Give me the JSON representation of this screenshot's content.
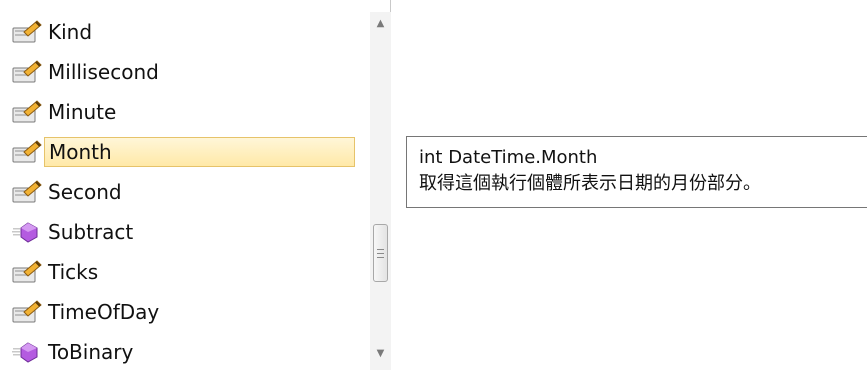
{
  "list": {
    "items": [
      {
        "label": "Kind",
        "icon": "property-icon",
        "selected": false
      },
      {
        "label": "Millisecond",
        "icon": "property-icon",
        "selected": false
      },
      {
        "label": "Minute",
        "icon": "property-icon",
        "selected": false
      },
      {
        "label": "Month",
        "icon": "property-icon",
        "selected": true
      },
      {
        "label": "Second",
        "icon": "property-icon",
        "selected": false
      },
      {
        "label": "Subtract",
        "icon": "method-icon",
        "selected": false
      },
      {
        "label": "Ticks",
        "icon": "property-icon",
        "selected": false
      },
      {
        "label": "TimeOfDay",
        "icon": "property-icon",
        "selected": false
      },
      {
        "label": "ToBinary",
        "icon": "method-icon",
        "selected": false
      }
    ]
  },
  "tooltip": {
    "signature": "int DateTime.Month",
    "description": "取得這個執行個體所表示日期的月份部分。"
  },
  "colors": {
    "selection_fill": "#ffe9a8",
    "selection_border": "#e6c36a",
    "method_icon": "#a64dd6"
  }
}
